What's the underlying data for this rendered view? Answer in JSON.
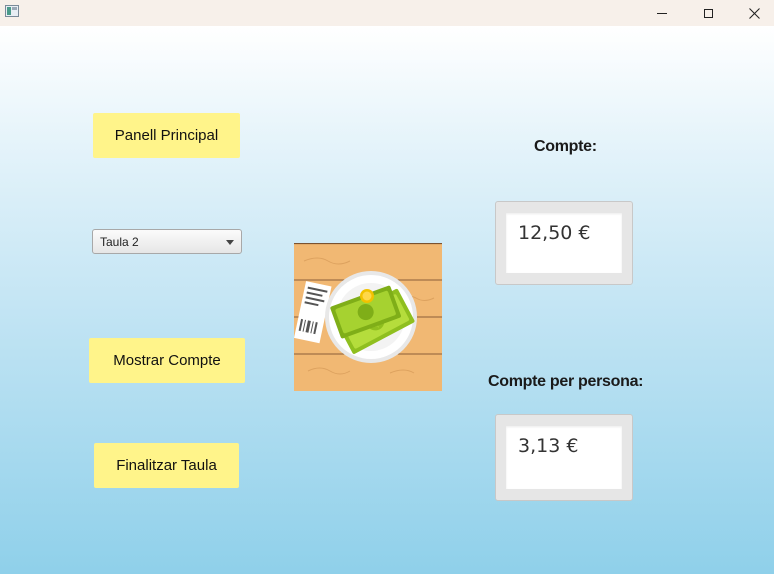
{
  "window": {
    "title": "",
    "controls": {
      "minimize_icon": "minimize-icon",
      "maximize_icon": "maximize-icon",
      "close_icon": "close-icon"
    }
  },
  "buttons": {
    "panell_principal": "Panell Principal",
    "mostrar_compte": "Mostrar Compte",
    "finalitzar_taula": "Finalitzar Taula"
  },
  "table_select": {
    "selected": "Taula 2"
  },
  "bill": {
    "label": "Compte:",
    "value": "12,50 €"
  },
  "per_person": {
    "label": "Compte per persona:",
    "value": "3,13 €"
  },
  "image": {
    "icon": "bill-money-plate-icon"
  },
  "colors": {
    "button_bg": "#fff48a",
    "gradient_top": "#ffffff",
    "gradient_bottom": "#8fd0ea"
  }
}
